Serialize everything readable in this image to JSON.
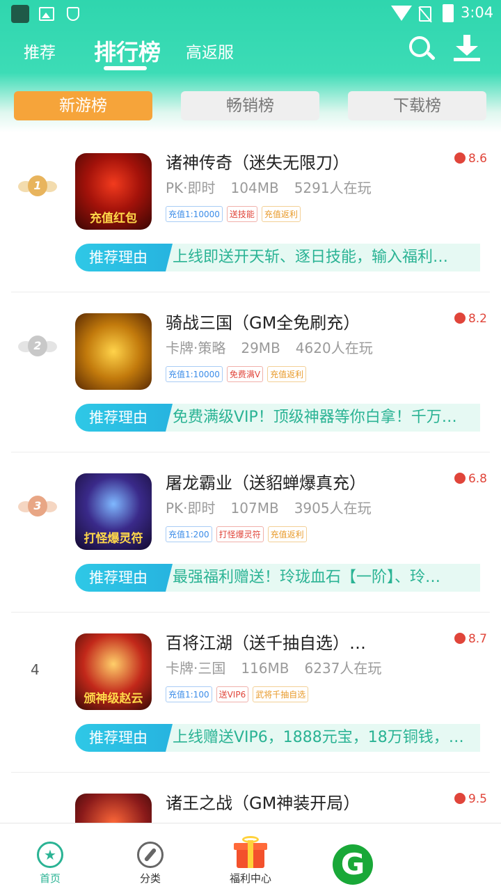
{
  "statusbar": {
    "time": "3:04"
  },
  "top_tabs": {
    "recommend": "推荐",
    "ranking": "排行榜",
    "high_return": "高返服"
  },
  "sub_tabs": {
    "new_games": "新游榜",
    "best_sellers": "畅销榜",
    "downloads": "下载榜"
  },
  "reason_label": "推荐理由",
  "games": [
    {
      "rank": "1",
      "title": "诸神传奇（迷失无限刀）",
      "rating": "8.6",
      "genre": "PK·即时",
      "size": "104MB",
      "players": "5291人在玩",
      "icon_caption": "充值红包",
      "tags": [
        "充值1:10000",
        "送技能",
        "充值返利"
      ],
      "reason": "上线即送开天斩、逐日技能，输入福利…"
    },
    {
      "rank": "2",
      "title": "骑战三国（GM全免刷充）",
      "rating": "8.2",
      "genre": "卡牌·策略",
      "size": "29MB",
      "players": "4620人在玩",
      "icon_caption": "",
      "tags": [
        "充值1:10000",
        "免费满V",
        "充值返利"
      ],
      "reason": "免费满级VIP！顶级神器等你白拿！千万…"
    },
    {
      "rank": "3",
      "title": "屠龙霸业（送貂蝉爆真充）",
      "rating": "6.8",
      "genre": "PK·即时",
      "size": "107MB",
      "players": "3905人在玩",
      "icon_caption": "打怪爆灵符",
      "tags": [
        "充值1:200",
        "打怪爆灵符",
        "充值返利"
      ],
      "reason": "最强福利赠送！玲珑血石【一阶】、玲…"
    },
    {
      "rank": "4",
      "title": "百将江湖（送千抽自选）…",
      "rating": "8.7",
      "genre": "卡牌·三国",
      "size": "116MB",
      "players": "6237人在玩",
      "icon_caption": "颁神级赵云",
      "tags": [
        "充值1:100",
        "送VIP6",
        "武将千抽自选"
      ],
      "reason": "上线赠送VIP6，1888元宝，18万铜钱，…"
    },
    {
      "title": "诸王之战（GM神装开局）",
      "rating": "9.5"
    }
  ],
  "bottom_nav": {
    "home": "首页",
    "category": "分类",
    "welfare": "福利中心"
  },
  "colors": {
    "accent": "#2fd6ae",
    "active_subtab": "#f6a43a",
    "reason_text": "#2ab394",
    "rating": "#e0453a"
  }
}
